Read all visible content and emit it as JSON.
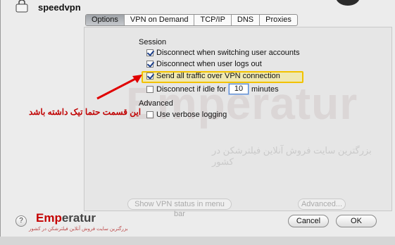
{
  "vpn": {
    "name": "speedvpn",
    "icon": "vpn-lock-icon"
  },
  "tabs": [
    {
      "label": "Options",
      "selected": true
    },
    {
      "label": "VPN on Demand",
      "selected": false
    },
    {
      "label": "TCP/IP",
      "selected": false
    },
    {
      "label": "DNS",
      "selected": false
    },
    {
      "label": "Proxies",
      "selected": false
    }
  ],
  "session": {
    "heading": "Session",
    "options": [
      {
        "label": "Disconnect when switching user accounts",
        "checked": true
      },
      {
        "label": "Disconnect when user logs out",
        "checked": true
      },
      {
        "label": "Send all traffic over VPN connection",
        "checked": true
      },
      {
        "label_before": "Disconnect if idle for",
        "value": "10",
        "label_after": "minutes",
        "checked": false
      }
    ]
  },
  "advanced": {
    "heading": "Advanced",
    "options": [
      {
        "label": "Use verbose logging",
        "checked": false
      }
    ]
  },
  "annotation": "این قسمت حتما تیک داشته باشد",
  "watermark": {
    "main": "Emperatur",
    "sub": "بزرگترین سایت فروش آنلاین فیلترشکن در کشور"
  },
  "background_buttons": {
    "show_vpn": "Show VPN status in menu bar",
    "advanced": "Advanced..."
  },
  "logo": {
    "em": "Emp",
    "rest": "eratur",
    "sub": "بزرگترین سایت فروش آنلاین فیلترشکن در کشور"
  },
  "buttons": {
    "help": "?",
    "cancel": "Cancel",
    "ok": "OK"
  },
  "colors": {
    "highlight": "#f2c200",
    "annotation": "#c00000",
    "arrow": "#e00000"
  }
}
